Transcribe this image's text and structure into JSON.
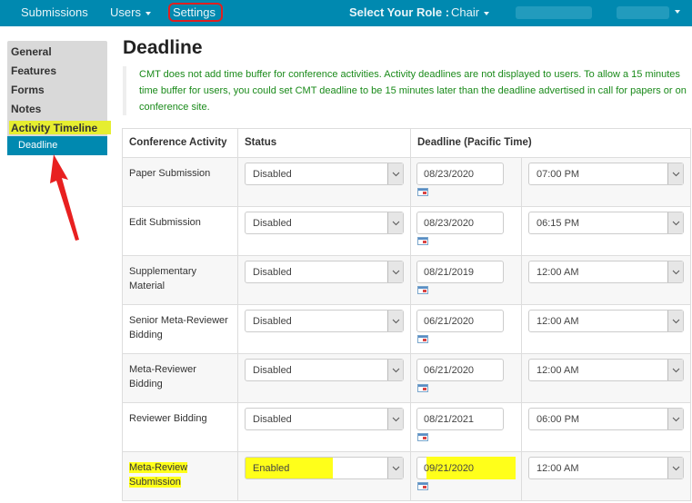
{
  "navbar": {
    "items": [
      {
        "label": "Submissions",
        "has_dropdown": false
      },
      {
        "label": "Users",
        "has_dropdown": true
      },
      {
        "label": "Settings",
        "has_dropdown": false,
        "annotated": true
      }
    ],
    "role_label": "Select Your Role :",
    "role_value": "Chair",
    "user_menu": "(redacted)"
  },
  "sidebar": {
    "items": [
      {
        "label": "General"
      },
      {
        "label": "Features"
      },
      {
        "label": "Forms"
      },
      {
        "label": "Notes"
      },
      {
        "label": "Activity Timeline",
        "highlighted": true
      }
    ],
    "active_subitem": "Deadline"
  },
  "page": {
    "title": "Deadline",
    "notice": "CMT does not add time buffer for conference activities. Activity deadlines are not displayed to users. To allow a 15 minutes time buffer for users, you could set CMT deadline to be 15 minutes later than the deadline advertised in call for papers or on conference site."
  },
  "table": {
    "headers": [
      "Conference Activity",
      "Status",
      "Deadline (Pacific Time)"
    ],
    "rows": [
      {
        "activity": "Paper Submission",
        "status": "Disabled",
        "date": "08/23/2020",
        "time": "07:00 PM"
      },
      {
        "activity": "Edit Submission",
        "status": "Disabled",
        "date": "08/23/2020",
        "time": "06:15 PM"
      },
      {
        "activity": "Supplementary Material",
        "status": "Disabled",
        "date": "08/21/2019",
        "time": "12:00 AM"
      },
      {
        "activity": "Senior Meta-Reviewer Bidding",
        "status": "Disabled",
        "date": "06/21/2020",
        "time": "12:00 AM"
      },
      {
        "activity": "Meta-Reviewer Bidding",
        "status": "Disabled",
        "date": "06/21/2020",
        "time": "12:00 AM"
      },
      {
        "activity": "Reviewer Bidding",
        "status": "Disabled",
        "date": "08/21/2021",
        "time": "06:00 PM"
      },
      {
        "activity": "Meta-Review Submission",
        "status": "Enabled",
        "date": "09/21/2020",
        "time": "12:00 AM",
        "highlighted": true
      }
    ]
  },
  "colors": {
    "navbar": "#0089b0",
    "notice_text": "#1a8a1a",
    "highlight": "#ffff1a",
    "annotation_red": "#e02020"
  }
}
